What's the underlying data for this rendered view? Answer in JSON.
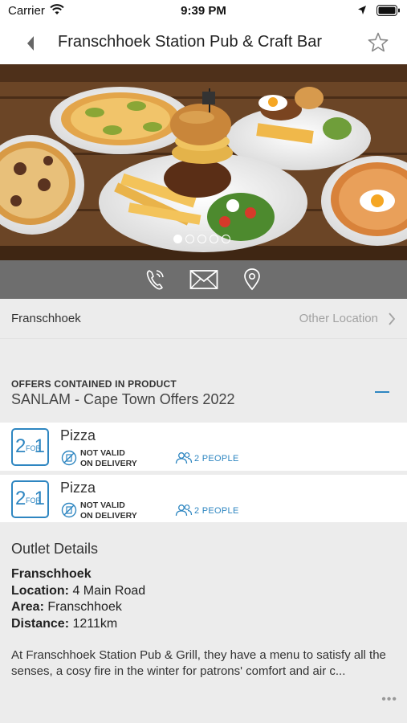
{
  "status_bar": {
    "carrier": "Carrier",
    "time": "9:39 PM"
  },
  "nav": {
    "title": "Franschhoek Station Pub & Craft Bar"
  },
  "hero": {
    "image_count": 5,
    "active_index": 0
  },
  "location": {
    "city": "Franschhoek",
    "other_label": "Other Location"
  },
  "offers_section": {
    "label": "OFFERS CONTAINED IN PRODUCT",
    "name": "SANLAM - Cape Town Offers 2022"
  },
  "offers": [
    {
      "badge_left": "2",
      "badge_mid": "FOR",
      "badge_right": "1",
      "name": "Pizza",
      "restriction_line1": "NOT VALID",
      "restriction_line2": "ON DELIVERY",
      "people": "2 PEOPLE"
    },
    {
      "badge_left": "2",
      "badge_mid": "FOR",
      "badge_right": "1",
      "name": "Pizza",
      "restriction_line1": "NOT VALID",
      "restriction_line2": "ON DELIVERY",
      "people": "2 PEOPLE"
    }
  ],
  "details": {
    "heading": "Outlet Details",
    "outlet_name": "Franschhoek",
    "location_label": "Location:",
    "location_value": "4 Main Road",
    "area_label": "Area:",
    "area_value": "Franschhoek",
    "distance_label": "Distance:",
    "distance_value": "1211km",
    "description": "At Franschhoek Station Pub & Grill, they have a menu to satisfy all the senses, a cosy fire in the winter for patrons' comfort and air c...",
    "more": "•••"
  },
  "colors": {
    "accent": "#2e86c1",
    "action_bar": "#6e6e6e",
    "background": "#ececec"
  }
}
